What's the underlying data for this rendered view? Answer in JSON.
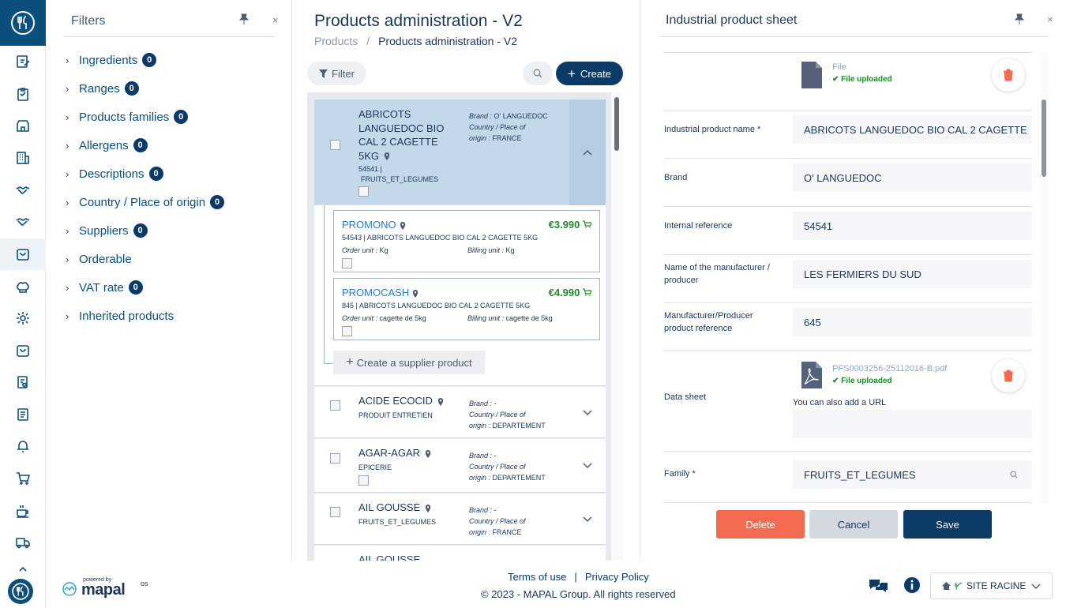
{
  "filters": {
    "title": "Filters",
    "items": [
      {
        "label": "Ingredients",
        "count": "0"
      },
      {
        "label": "Ranges",
        "count": "0"
      },
      {
        "label": "Products families",
        "count": "0"
      },
      {
        "label": "Allergens",
        "count": "0"
      },
      {
        "label": "Descriptions",
        "count": "0"
      },
      {
        "label": "Country / Place of origin",
        "count": "0"
      },
      {
        "label": "Suppliers",
        "count": "0"
      },
      {
        "label": "Orderable",
        "count": ""
      },
      {
        "label": "VAT rate",
        "count": "0"
      },
      {
        "label": "Inherited products",
        "count": ""
      }
    ]
  },
  "main": {
    "title": "Products administration - V2",
    "breadcrumb": {
      "root": "Products",
      "sep": "/",
      "current": "Products administration - V2"
    },
    "filter_label": "Filter",
    "create_label": "Create",
    "add_supplier_label": "Create a supplier product",
    "products": [
      {
        "name": "ABRICOTS LANGUEDOC BIO CAL 2 CAGETTE 5KG",
        "name_lines": [
          "ABRICOTS",
          "LANGUEDOC BIO",
          "CAL 2 CAGETTE",
          "5KG"
        ],
        "sub": "54541 |",
        "family": "FRUITS_ET_LEGUMES",
        "brand_label": "Brand :",
        "brand": "O' LANGUEDOC",
        "origin_label": "Country / Place of",
        "origin_label2": "origin :",
        "origin": "FRANCE"
      },
      {
        "name": "ACIDE ECOCID",
        "sub": "PRODUIT ENTRETIEN",
        "brand_label": "Brand :",
        "brand": "-",
        "origin_label": "Country / Place of",
        "origin_label2": "origin :",
        "origin": "DEPARTEMENT"
      },
      {
        "name": "AGAR-AGAR",
        "sub": "EPICERIE",
        "brand_label": "Brand :",
        "brand": "-",
        "origin_label": "Country / Place of",
        "origin_label2": "origin :",
        "origin": "DEPARTEMENT"
      },
      {
        "name": "AIL GOUSSE",
        "sub": "FRUITS_ET_LEGUMES",
        "brand_label": "Brand :",
        "brand": "-",
        "origin_label": "Country / Place of",
        "origin_label2": "origin :",
        "origin": "FRANCE"
      },
      {
        "name": "AIL GOUSSE"
      }
    ],
    "suppliers": [
      {
        "name": "PROMONO",
        "price": "€3.990",
        "desc": "54543 | ABRICOTS LANGUEDOC BIO CAL 2 CAGETTE 5KG",
        "order_label": "Order unit :",
        "order_unit": "Kg",
        "billing_label": "Billing unit :",
        "billing_unit": "Kg"
      },
      {
        "name": "PROMOCASH",
        "price": "€4.990",
        "desc": "845 | ABRICOTS LANGUEDOC BIO CAL 2 CAGETTE 5KG",
        "order_label": "Order unit :",
        "order_unit": "cagette de 5kg",
        "billing_label": "Billing unit :",
        "billing_unit": "cagette de 5kg"
      }
    ]
  },
  "sheet": {
    "title": "Industrial product sheet",
    "file": {
      "name": "File",
      "status": "File uploaded"
    },
    "fields": [
      {
        "label": "Industrial product name *",
        "value": "ABRICOTS LANGUEDOC BIO CAL 2 CAGETTE"
      },
      {
        "label": "Brand",
        "value": "O' LANGUEDOC"
      },
      {
        "label": "Internal reference",
        "value": "54541"
      },
      {
        "label": "Name of the manufacturer / producer",
        "value": "LES FERMIERS DU SUD"
      },
      {
        "label": "Manufacturer/Producer product reference",
        "value": "645"
      }
    ],
    "datasheet": {
      "label": "Data sheet",
      "filename": "PFS0003256-25112016-B.pdf",
      "status": "File uploaded",
      "url_hint": "You can also add a URL",
      "url_value": ""
    },
    "family": {
      "label": "Family *",
      "value": "FRUITS_ET_LEGUMES"
    },
    "buttons": {
      "delete": "Delete",
      "cancel": "Cancel",
      "save": "Save"
    }
  },
  "footer": {
    "terms": "Terms of use",
    "sep": "|",
    "privacy": "Privacy Policy",
    "copyright": "© 2023 - MAPAL Group. All rights reserved",
    "powered_by": "powered by",
    "brand": "mapal",
    "brand_suffix": "os",
    "site": "SITE RACINE"
  },
  "colors": {
    "primary": "#0b3a66",
    "accent": "#2d7ac4",
    "danger": "#f26b4f",
    "success": "#1f8b2a"
  },
  "nav_icons": [
    "logo-icon",
    "edit-icon",
    "clipboard-icon",
    "store-icon",
    "building-icon",
    "handshake-icon",
    "handshake-icon",
    "bag-icon",
    "chef-hat-icon",
    "gear-icon",
    "bag-icon",
    "document-heart-icon",
    "document-icon",
    "bell-icon",
    "cart-icon",
    "coffee-icon",
    "truck-icon",
    "chevron-up-icon",
    "logo-icon"
  ]
}
